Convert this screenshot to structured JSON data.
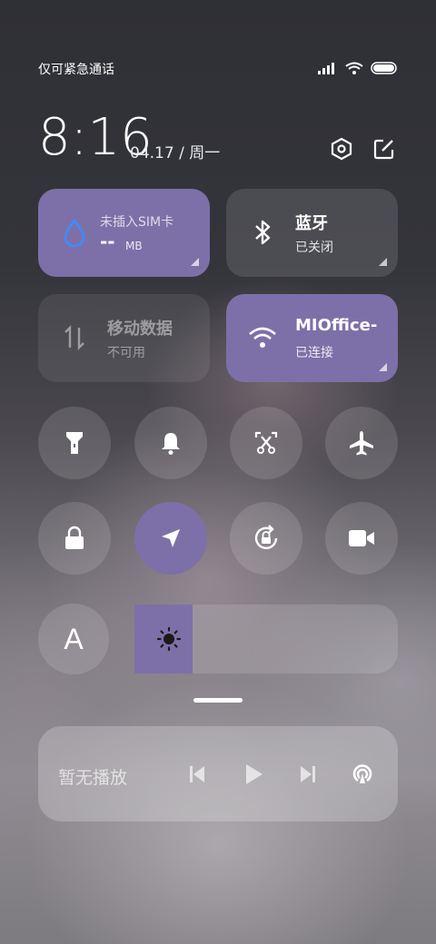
{
  "status_bar": {
    "carrier": "仅可紧急通话",
    "icons": [
      "signal-icon",
      "wifi-icon",
      "battery-icon"
    ]
  },
  "header": {
    "time": "8:16",
    "date": "04.17 / 周一",
    "actions": [
      "settings-icon",
      "edit-icon"
    ]
  },
  "tiles": {
    "sim": {
      "title": "未插入SIM卡",
      "value": "--",
      "unit": "MB",
      "icon": "water-drop-icon",
      "accent": "#3a8cff"
    },
    "bluetooth": {
      "title": "蓝牙",
      "status": "已关闭",
      "icon": "bluetooth-icon"
    },
    "mobile_data": {
      "title": "移动数据",
      "status": "不可用",
      "icon": "data-arrows-icon"
    },
    "wifi": {
      "title": "MIOffice-",
      "status": "已连接",
      "icon": "wifi-icon"
    }
  },
  "toggles": [
    {
      "name": "flashlight",
      "icon": "flashlight-icon",
      "active": false
    },
    {
      "name": "bell",
      "icon": "bell-icon",
      "active": false
    },
    {
      "name": "screenshot",
      "icon": "screenshot-scissors-icon",
      "active": false
    },
    {
      "name": "airplane",
      "icon": "airplane-icon",
      "active": false
    },
    {
      "name": "lock",
      "icon": "lock-icon",
      "active": false
    },
    {
      "name": "location",
      "icon": "location-arrow-icon",
      "active": true
    },
    {
      "name": "rotation-lock",
      "icon": "rotation-lock-icon",
      "active": false
    },
    {
      "name": "video",
      "icon": "video-camera-icon",
      "active": false
    }
  ],
  "font_toggle": {
    "label": "A"
  },
  "brightness": {
    "level": 0.22,
    "icon": "sun-icon"
  },
  "media": {
    "label": "暂无播放",
    "controls": [
      "previous-icon",
      "play-icon",
      "next-icon",
      "cast-icon"
    ]
  },
  "colors": {
    "accent": "#7d70a8"
  }
}
